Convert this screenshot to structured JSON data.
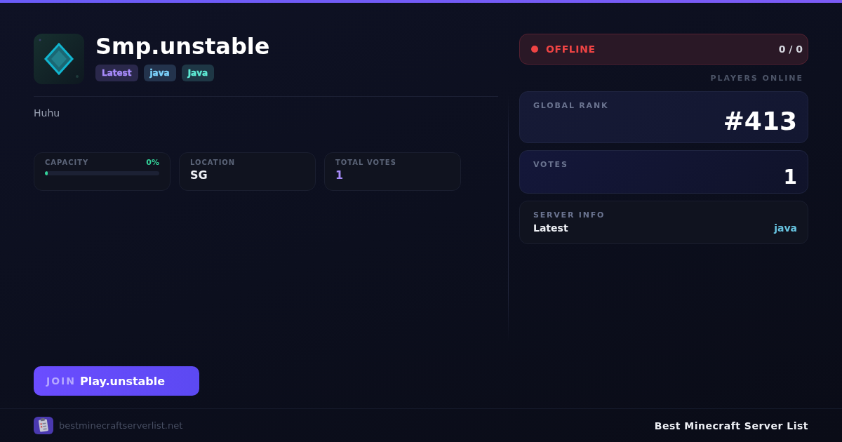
{
  "server": {
    "name": "Smp.unstable",
    "tags": [
      {
        "label": "Latest",
        "color": "#a78bfa"
      },
      {
        "label": "java",
        "color": "#7dd3fc"
      },
      {
        "label": "Java",
        "color": "#5eead4"
      }
    ],
    "description": "Huhu"
  },
  "stats": [
    {
      "kind": "meter",
      "label": "CAPACITY",
      "reading": "0%",
      "level": 0
    },
    {
      "kind": "value",
      "label": "LOCATION",
      "value": "SG"
    },
    {
      "kind": "highlight",
      "label": "TOTAL VOTES",
      "value": "1"
    }
  ],
  "join_button": {
    "prefix": "JOIN",
    "address": "Play.unstable"
  },
  "status": {
    "online": false,
    "label": "OFFLINE",
    "players": "0 / 0",
    "caption": "PLAYERS ONLINE"
  },
  "cards": [
    {
      "kind": "rank",
      "label": "GLOBAL RANK",
      "value": "#413"
    },
    {
      "kind": "count",
      "label": "VOTES",
      "value": "1"
    },
    {
      "kind": "info",
      "label": "SERVER INFO",
      "version": "Latest",
      "platform": "java"
    }
  ],
  "footer": {
    "domain": "bestminecraftserverlist.net",
    "brand": "Best Minecraft Server List"
  }
}
